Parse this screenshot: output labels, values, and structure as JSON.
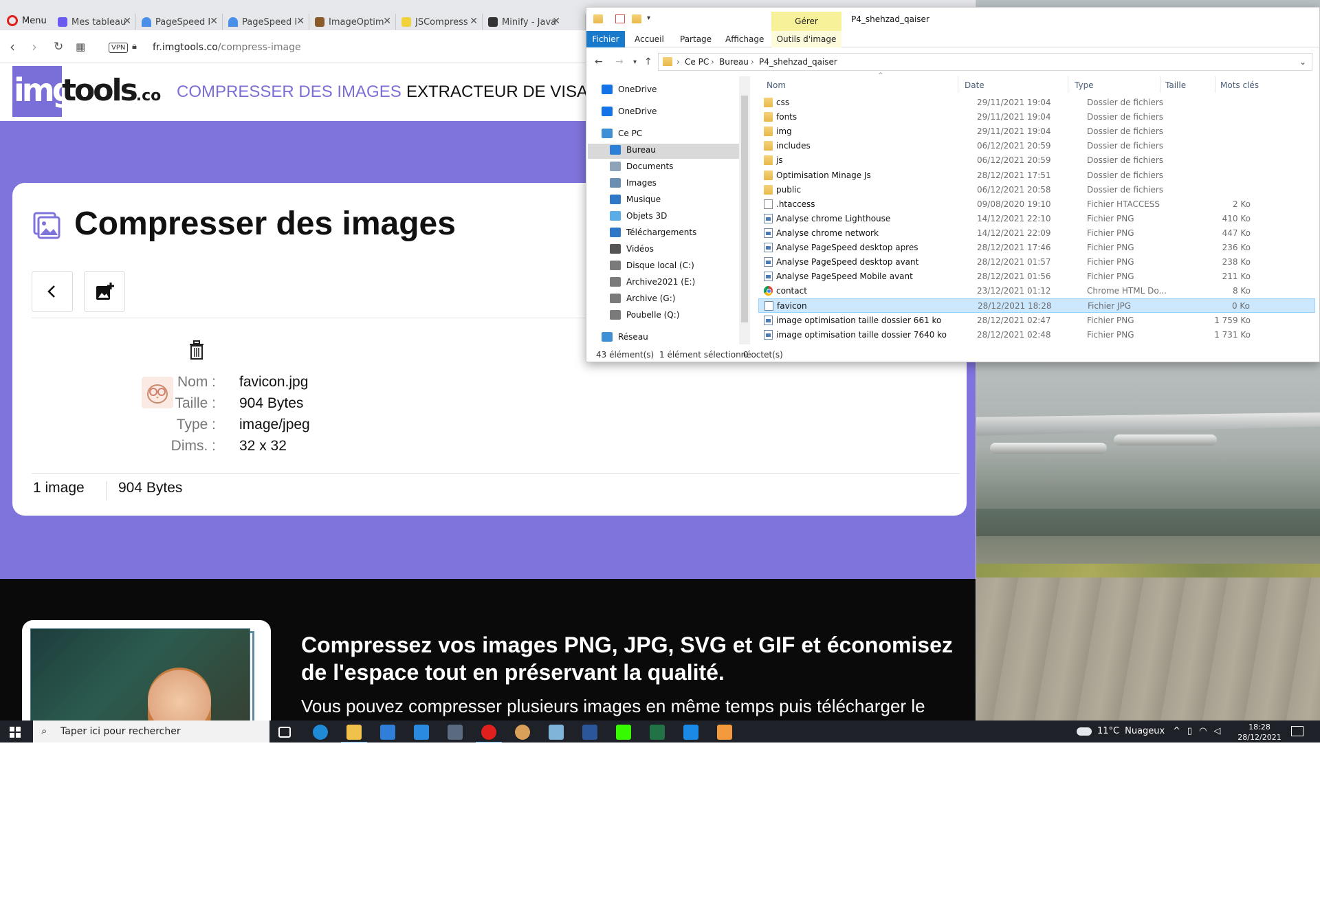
{
  "browser": {
    "menu_label": "Menu",
    "tabs": [
      {
        "label": "Mes tableaux",
        "color": "#6a5cf0"
      },
      {
        "label": "PageSpeed In",
        "color": "#4a8fe8"
      },
      {
        "label": "PageSpeed In",
        "color": "#4a8fe8"
      },
      {
        "label": "ImageOptim",
        "color": "#8a5a2b"
      },
      {
        "label": "JSCompress",
        "color": "#f0d23c"
      },
      {
        "label": "Minify - JavaS",
        "color": "#333333"
      }
    ],
    "vpn_label": "VPN",
    "url_host": "fr.imgtools.co",
    "url_path": "/compress-image"
  },
  "site": {
    "logo_img": "img",
    "logo_tools": "tools",
    "logo_co": ".co",
    "nav": [
      "COMPRESSER DES IMAGES",
      "EXTRACTEUR DE VISAGES"
    ],
    "accent": "#7f73dc",
    "card_title": "Compresser des images",
    "file": {
      "name_label": "Nom :",
      "name": "favicon.jpg",
      "size_label": "Taille :",
      "size": "904 Bytes",
      "type_label": "Type :",
      "type": "image/jpeg",
      "dims_label": "Dims. :",
      "dims": "32 x 32"
    },
    "summary_count": "1 image",
    "summary_size": "904 Bytes",
    "promo_title": "Compressez vos images PNG, JPG, SVG et GIF et économisez de l'espace tout en préservant la qualité.",
    "promo_text": "Vous pouvez compresser plusieurs images en même temps puis télécharger le"
  },
  "explorer": {
    "manage_tab": "Gérer",
    "window_title": "P4_shehzad_qaiser",
    "ribbon_tabs": [
      "Fichier",
      "Accueil",
      "Partage",
      "Affichage",
      "Outils d'image"
    ],
    "breadcrumb": [
      "Ce PC",
      "Bureau",
      "P4_shehzad_qaiser"
    ],
    "tree": [
      {
        "label": "OneDrive",
        "icon": "cloud-icon",
        "color": "#1473e6"
      },
      {
        "label": "OneDrive",
        "icon": "cloud-icon",
        "color": "#1473e6"
      },
      {
        "label": "Ce PC",
        "icon": "computer-icon",
        "color": "#3f8fd6"
      },
      {
        "label": "Bureau",
        "icon": "desktop-icon",
        "color": "#2b7fd6"
      },
      {
        "label": "Documents",
        "icon": "document-icon",
        "color": "#8fa3b8"
      },
      {
        "label": "Images",
        "icon": "image-icon",
        "color": "#6a8fb3"
      },
      {
        "label": "Musique",
        "icon": "music-icon",
        "color": "#2f78c8"
      },
      {
        "label": "Objets 3D",
        "icon": "cube-icon",
        "color": "#5aaee8"
      },
      {
        "label": "Téléchargements",
        "icon": "download-icon",
        "color": "#2f78c8"
      },
      {
        "label": "Vidéos",
        "icon": "video-icon",
        "color": "#555555"
      },
      {
        "label": "Disque local (C:)",
        "icon": "drive-icon",
        "color": "#7a7a7a"
      },
      {
        "label": "Archive2021 (E:)",
        "icon": "drive-icon",
        "color": "#7a7a7a"
      },
      {
        "label": "Archive (G:)",
        "icon": "drive-icon",
        "color": "#7a7a7a"
      },
      {
        "label": "Poubelle (Q:)",
        "icon": "drive-icon",
        "color": "#7a7a7a"
      },
      {
        "label": "Réseau",
        "icon": "network-icon",
        "color": "#3f8fd6"
      }
    ],
    "columns": [
      "Nom",
      "Date",
      "Type",
      "Taille",
      "Mots clés"
    ],
    "files": [
      {
        "name": "css",
        "date": "29/11/2021 19:04",
        "type": "Dossier de fichiers",
        "size": "",
        "kind": "folder"
      },
      {
        "name": "fonts",
        "date": "29/11/2021 19:04",
        "type": "Dossier de fichiers",
        "size": "",
        "kind": "folder"
      },
      {
        "name": "img",
        "date": "29/11/2021 19:04",
        "type": "Dossier de fichiers",
        "size": "",
        "kind": "folder"
      },
      {
        "name": "includes",
        "date": "06/12/2021 20:59",
        "type": "Dossier de fichiers",
        "size": "",
        "kind": "folder"
      },
      {
        "name": "js",
        "date": "06/12/2021 20:59",
        "type": "Dossier de fichiers",
        "size": "",
        "kind": "folder"
      },
      {
        "name": "Optimisation Minage Js",
        "date": "28/12/2021 17:51",
        "type": "Dossier de fichiers",
        "size": "",
        "kind": "folder"
      },
      {
        "name": "public",
        "date": "06/12/2021 20:58",
        "type": "Dossier de fichiers",
        "size": "",
        "kind": "folder"
      },
      {
        "name": ".htaccess",
        "date": "09/08/2020 19:10",
        "type": "Fichier HTACCESS",
        "size": "2 Ko",
        "kind": "file"
      },
      {
        "name": "Analyse chrome Lighthouse",
        "date": "14/12/2021 22:10",
        "type": "Fichier PNG",
        "size": "410 Ko",
        "kind": "png"
      },
      {
        "name": "Analyse chrome network",
        "date": "14/12/2021 22:09",
        "type": "Fichier PNG",
        "size": "447 Ko",
        "kind": "png"
      },
      {
        "name": "Analyse PageSpeed desktop apres",
        "date": "28/12/2021 17:46",
        "type": "Fichier PNG",
        "size": "236 Ko",
        "kind": "png"
      },
      {
        "name": "Analyse PageSpeed desktop avant",
        "date": "28/12/2021 01:57",
        "type": "Fichier PNG",
        "size": "238 Ko",
        "kind": "png"
      },
      {
        "name": "Analyse PageSpeed Mobile avant",
        "date": "28/12/2021 01:56",
        "type": "Fichier PNG",
        "size": "211 Ko",
        "kind": "png"
      },
      {
        "name": "contact",
        "date": "23/12/2021 01:12",
        "type": "Chrome HTML Do...",
        "size": "8 Ko",
        "kind": "chrome"
      },
      {
        "name": "favicon",
        "date": "28/12/2021 18:28",
        "type": "Fichier JPG",
        "size": "0 Ko",
        "kind": "jpg",
        "selected": true
      },
      {
        "name": "image optimisation taille dossier 661 ko",
        "date": "28/12/2021 02:47",
        "type": "Fichier PNG",
        "size": "1 759 Ko",
        "kind": "png"
      },
      {
        "name": "image optimisation taille dossier 7640 ko",
        "date": "28/12/2021 02:48",
        "type": "Fichier PNG",
        "size": "1 731 Ko",
        "kind": "png"
      }
    ],
    "status_count": "43 élément(s)",
    "status_selected": "1 élément sélectionné",
    "status_bytes": "0 octet(s)"
  },
  "taskbar": {
    "search_placeholder": "Taper ici pour rechercher",
    "apps": [
      {
        "name": "task-view-icon",
        "color": "#1f2128"
      },
      {
        "name": "edge-icon",
        "color": "#1f8ad6"
      },
      {
        "name": "file-explorer-icon",
        "color": "#f0c24a",
        "active": true
      },
      {
        "name": "store-icon",
        "color": "#2f7ed8"
      },
      {
        "name": "mail-icon",
        "color": "#2a8ae0"
      },
      {
        "name": "calculator-icon",
        "color": "#5a6b80"
      },
      {
        "name": "opera-icon",
        "color": "#e0201c",
        "active": true
      },
      {
        "name": "paint-icon",
        "color": "#d9a05a"
      },
      {
        "name": "notes-icon",
        "color": "#7fb4d8"
      },
      {
        "name": "word-icon",
        "color": "#2b579a"
      },
      {
        "name": "dreamweaver-icon",
        "color": "#35fa00"
      },
      {
        "name": "excel-icon",
        "color": "#217346"
      },
      {
        "name": "vscode-icon",
        "color": "#1a8ae6"
      },
      {
        "name": "sublime-icon",
        "color": "#f29a3c"
      }
    ],
    "weather_temp": "11°C",
    "weather_text": "Nuageux",
    "time": "18:28",
    "date": "28/12/2021"
  }
}
